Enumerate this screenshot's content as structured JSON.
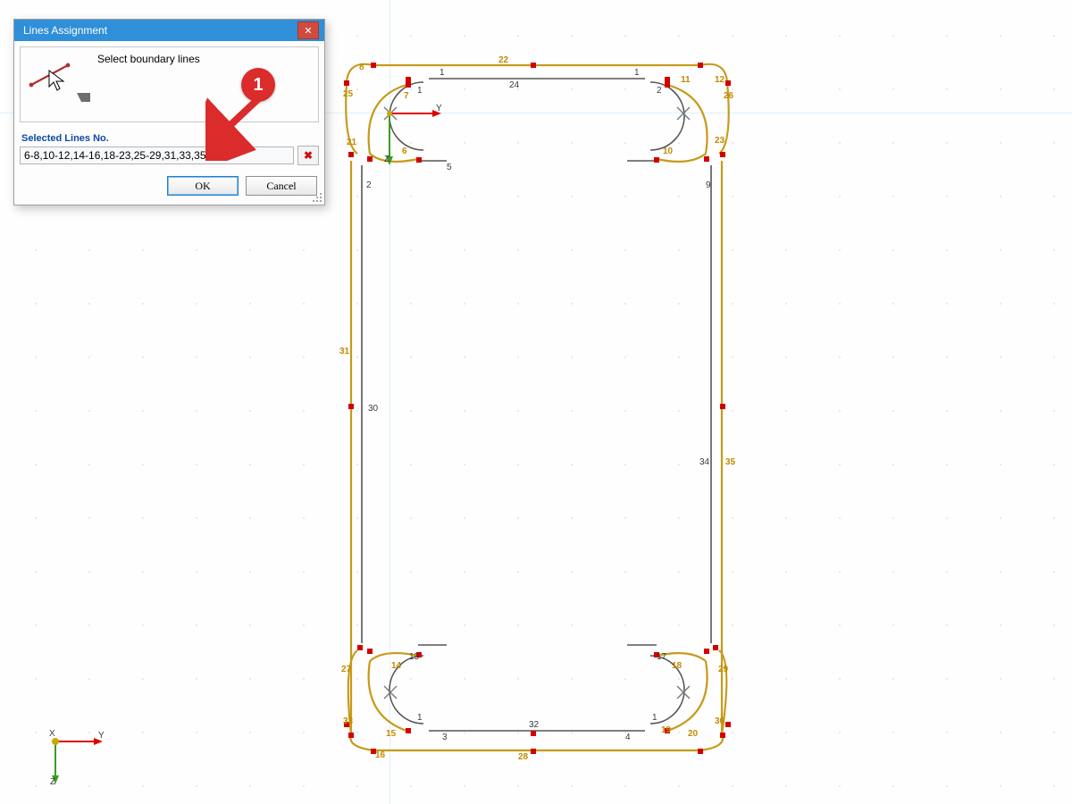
{
  "dialog": {
    "title": "Lines Assignment",
    "instruction": "Select boundary lines",
    "lines_label": "Selected Lines No.",
    "lines_value": "6-8,10-12,14-16,18-23,25-29,31,33,35,36",
    "ok": "OK",
    "cancel": "Cancel",
    "close_tooltip": "Close"
  },
  "callout": {
    "badge": "1"
  },
  "ucs": {
    "x": "X",
    "y": "Y",
    "z": "Z"
  },
  "local_axes": {
    "y": "Y",
    "z": "Z"
  },
  "colors": {
    "selected": "#c79a1a",
    "edge": "#555555",
    "node": "#d20000",
    "accent": "#2f8fd8"
  },
  "labels_black": {
    "top_24": "24",
    "left_2": "2",
    "right_9": "9",
    "left_1a": "1",
    "tl_1b": "1",
    "tr_1c": "1",
    "tr_2d": "2",
    "l30": "30",
    "r34": "34",
    "bl_13": "13",
    "bl_1d": "1",
    "bl_3": "3",
    "br_17": "17",
    "br_4": "4",
    "br_1e": "1",
    "bot_32": "32",
    "top_5": "5"
  },
  "labels_orange": {
    "l31": "31",
    "r35": "35",
    "tl_8": "8",
    "tl_25": "25",
    "tl_21": "21",
    "tl_7": "7",
    "tl_6": "6",
    "top_22": "22",
    "tr_11": "11",
    "tr_12": "12",
    "tr_26": "26",
    "tr_23": "23",
    "tr_10": "10",
    "bl_27": "27",
    "bl_33": "33",
    "bl_14": "14",
    "bl_15": "15",
    "bl_16": "16",
    "br_18": "18",
    "br_29": "29",
    "br_19": "19",
    "br_20": "20",
    "br_36": "36",
    "bot_28": "28"
  }
}
